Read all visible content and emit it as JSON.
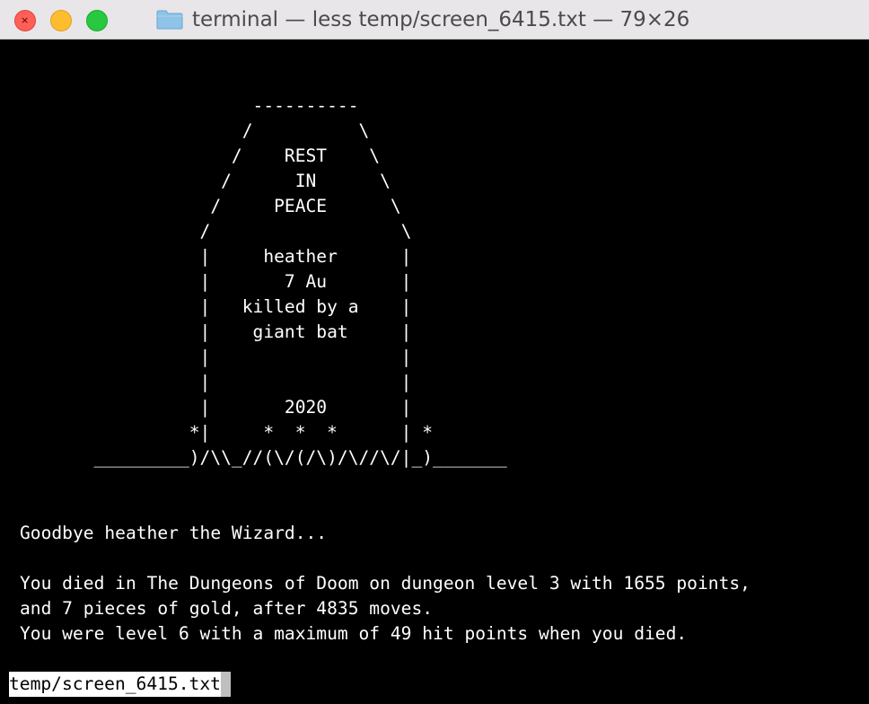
{
  "window": {
    "title": "terminal — less temp/screen_6415.txt — 79×26",
    "colors": {
      "background": "#000000",
      "text": "#ffffff",
      "titlebar": "#e8e6e8",
      "close": "#fe5f57",
      "minimize": "#febc2e",
      "maximize": "#28c840"
    },
    "folder_icon": "folder-icon",
    "close_glyph": "×"
  },
  "terminal": {
    "tombstone": [
      "                      ----------",
      "                     /          \\",
      "                    /    REST    \\",
      "                   /      IN      \\",
      "                  /     PEACE      \\",
      "                 /                  \\",
      "                 |     heather      |",
      "                 |       7 Au       |",
      "                 |   killed by a    |",
      "                 |    giant bat     |",
      "                 |                  |",
      "                 |                  |",
      "                 |       2020       |",
      "                *|     *  *  *      | *",
      "       _________)/\\\\_//(\\/(/\\)/\\//\\/|_)_______"
    ],
    "messages": [
      "",
      "",
      "Goodbye heather the Wizard...",
      "",
      "You died in The Dungeons of Doom on dungeon level 3 with 1655 points,",
      "and 7 pieces of gold, after 4835 moves.",
      "You were level 6 with a maximum of 49 hit points when you died."
    ],
    "prompt": "temp/screen_6415.txt"
  }
}
